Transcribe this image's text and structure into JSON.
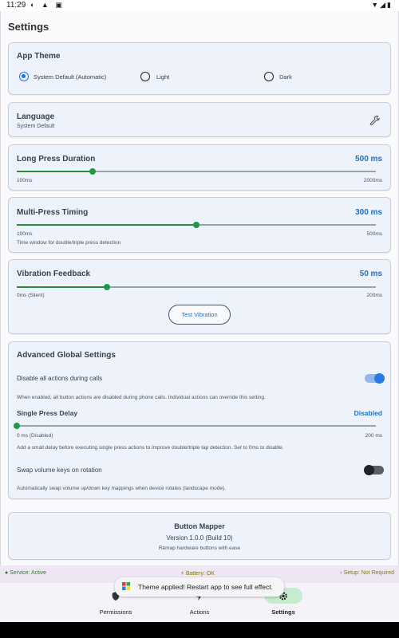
{
  "status_bar": {
    "time": "11:29"
  },
  "page_title": "Settings",
  "app_theme": {
    "title": "App Theme",
    "options": [
      {
        "label": "System Default (Automatic)",
        "selected": true
      },
      {
        "label": "Light",
        "selected": false
      },
      {
        "label": "Dark",
        "selected": false
      }
    ]
  },
  "language": {
    "title": "Language",
    "value": "System Default",
    "icon": "wrench-icon"
  },
  "long_press": {
    "title": "Long Press Duration",
    "value": "500 ms",
    "min_label": "100ms",
    "max_label": "2000ms",
    "level": 0.21
  },
  "multi_press": {
    "title": "Multi-Press Timing",
    "value": "300 ms",
    "min_label": "100ms",
    "max_label": "500ms",
    "level": 0.5,
    "description": "Time window for double/triple press detection"
  },
  "vibration": {
    "title": "Vibration Feedback",
    "value": "50 ms",
    "min_label": "0ms (Silent)",
    "max_label": "200ms",
    "level": 0.25,
    "test_button": "Test Vibration"
  },
  "advanced": {
    "title": "Advanced Global Settings",
    "disable_calls": {
      "label": "Disable all actions during calls",
      "enabled": true,
      "description": "When enabled, all button actions are disabled during phone calls. Individual actions can override this setting."
    },
    "single_press": {
      "label": "Single Press Delay",
      "value": "Disabled",
      "min_label": "0 ms (Disabled)",
      "max_label": "200 ms",
      "level": 0.0,
      "description": "Add a small delay before executing single press actions to improve double/triple tap detection. Set to 0ms to disable."
    },
    "swap_volume": {
      "label": "Swap volume keys on rotation",
      "enabled": false,
      "description": "Automatically swap volume up/down key mappings when device rotates (landscape mode)."
    }
  },
  "about": {
    "name": "Button Mapper",
    "version": "Version 1.0.0 (Build 10)",
    "tagline": "Remap hardware buttons with ease"
  },
  "info_strip": {
    "service": "● Service: Active",
    "battery": "⚡ Battery: OK",
    "setup": "› Setup: Not Required"
  },
  "toast": {
    "text": "Theme applied! Restart app to see full effect."
  },
  "nav": {
    "items": [
      {
        "label": "Permissions",
        "icon": "shield-icon",
        "active": false
      },
      {
        "label": "Actions",
        "icon": "bolt-icon",
        "active": false
      },
      {
        "label": "Settings",
        "icon": "gear-icon",
        "active": true
      }
    ]
  },
  "colors": {
    "accent": "#1a73c9",
    "slider": "#1e9a45",
    "toggle_on": "#2979e6",
    "nav_active": "#c7ebcf"
  }
}
